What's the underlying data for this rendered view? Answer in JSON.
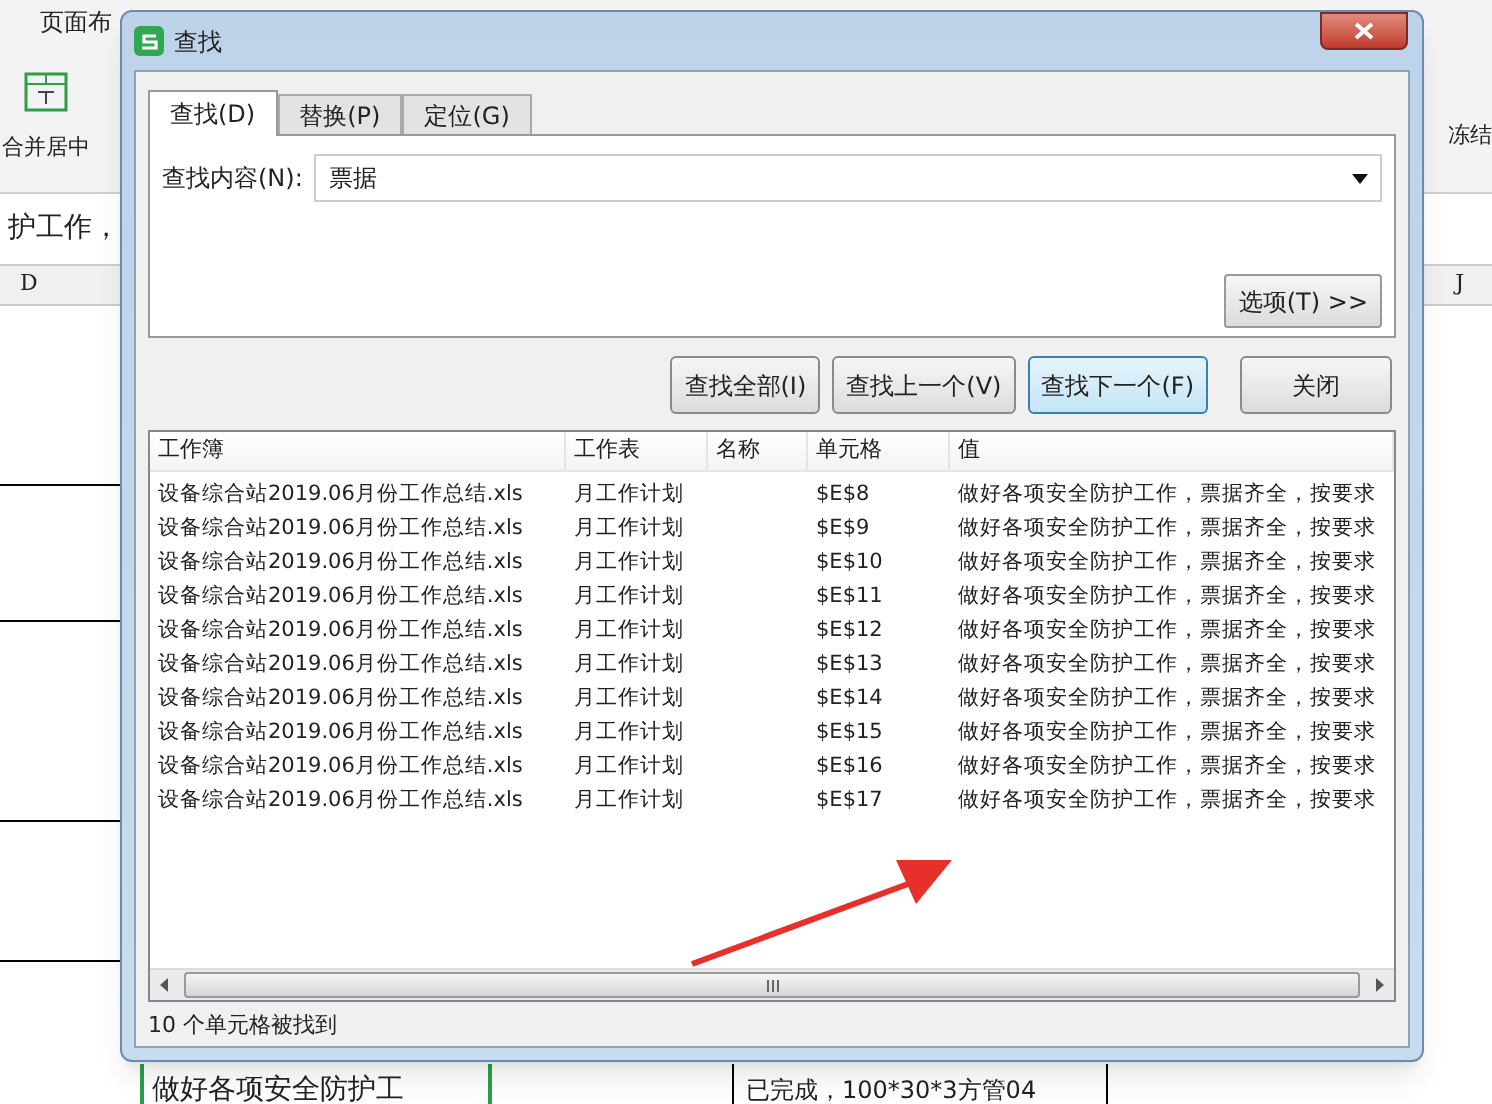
{
  "spreadsheet": {
    "menu_tab": "页面布",
    "ribbon_left": "合并居中",
    "ribbon_right": "冻结",
    "cell_text": "护工作，",
    "column_left": "D",
    "column_right": "J",
    "bottom_cells": [
      "做好各项安全防护工",
      "已完成，100*30*3方管04"
    ]
  },
  "dialog": {
    "title": "查找",
    "tabs": [
      {
        "label": "查找(D)",
        "selected": true
      },
      {
        "label": "替换(P)",
        "selected": false
      },
      {
        "label": "定位(G)",
        "selected": false
      }
    ],
    "find_label": "查找内容(N):",
    "find_value": "票据",
    "options_button": "选项(T) >>",
    "buttons": [
      {
        "label": "查找全部(I)",
        "focused": false
      },
      {
        "label": "查找上一个(V)",
        "focused": false
      },
      {
        "label": "查找下一个(F)",
        "focused": true
      },
      {
        "label": "关闭",
        "focused": false
      }
    ],
    "results": {
      "columns": [
        "工作簿",
        "工作表",
        "名称",
        "单元格",
        "值"
      ],
      "rows": [
        [
          "设备综合站2019.06月份工作总结.xls",
          "月工作计划",
          "",
          "$E$8",
          "做好各项安全防护工作，票据齐全，按要求"
        ],
        [
          "设备综合站2019.06月份工作总结.xls",
          "月工作计划",
          "",
          "$E$9",
          "做好各项安全防护工作，票据齐全，按要求"
        ],
        [
          "设备综合站2019.06月份工作总结.xls",
          "月工作计划",
          "",
          "$E$10",
          "做好各项安全防护工作，票据齐全，按要求"
        ],
        [
          "设备综合站2019.06月份工作总结.xls",
          "月工作计划",
          "",
          "$E$11",
          "做好各项安全防护工作，票据齐全，按要求"
        ],
        [
          "设备综合站2019.06月份工作总结.xls",
          "月工作计划",
          "",
          "$E$12",
          "做好各项安全防护工作，票据齐全，按要求"
        ],
        [
          "设备综合站2019.06月份工作总结.xls",
          "月工作计划",
          "",
          "$E$13",
          "做好各项安全防护工作，票据齐全，按要求"
        ],
        [
          "设备综合站2019.06月份工作总结.xls",
          "月工作计划",
          "",
          "$E$14",
          "做好各项安全防护工作，票据齐全，按要求"
        ],
        [
          "设备综合站2019.06月份工作总结.xls",
          "月工作计划",
          "",
          "$E$15",
          "做好各项安全防护工作，票据齐全，按要求"
        ],
        [
          "设备综合站2019.06月份工作总结.xls",
          "月工作计划",
          "",
          "$E$16",
          "做好各项安全防护工作，票据齐全，按要求"
        ],
        [
          "设备综合站2019.06月份工作总结.xls",
          "月工作计划",
          "",
          "$E$17",
          "做好各项安全防护工作，票据齐全，按要求"
        ]
      ]
    },
    "status": "10 个单元格被找到"
  }
}
